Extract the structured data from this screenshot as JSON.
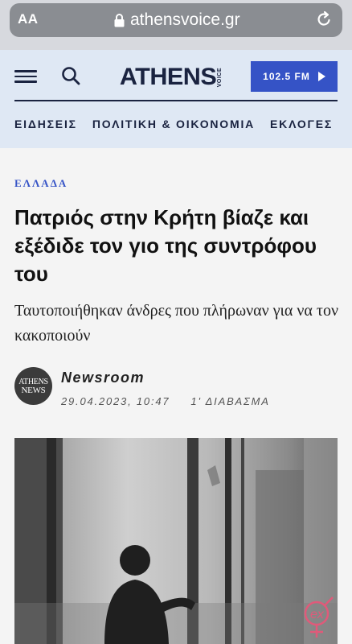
{
  "browser": {
    "text_size_label": "AA",
    "url": "athensvoice.gr",
    "icons": {
      "lock": "lock-icon",
      "reload": "reload-icon"
    }
  },
  "header": {
    "logo_text": "ATHENS",
    "logo_side_text": "VOICE",
    "radio_label": "102.5 FM",
    "icons": {
      "menu": "hamburger-menu-icon",
      "search": "search-icon",
      "play": "play-icon"
    },
    "nav_items": [
      "ΕΙΔΗΣΕΙΣ",
      "ΠΟΛΙΤΙΚΗ & ΟΙΚΟΝΟΜΙΑ",
      "ΕΚΛΟΓΕΣ"
    ]
  },
  "article": {
    "category": "ΕΛΛΑΔΑ",
    "headline": "Πατριός στην Κρήτη βίαζε και εξέδιδε τον γιο της συντρόφου του",
    "subheadline": "Ταυτοποιήθηκαν άνδρες που πλήρωναν για να τον κακοποιούν",
    "author": {
      "avatar_line1": "ATHENS",
      "avatar_line2": "NEWS",
      "name": "Newsroom",
      "date": "29.04.2023, 10:47",
      "read_time": "1' ΔΙΑΒΑΣΜΑ"
    },
    "watermark_text": "ex"
  },
  "colors": {
    "accent_blue": "#3553c6",
    "navy": "#1a2340",
    "header_bg": "#dfe8f4",
    "page_bg": "#f4f4f4"
  }
}
